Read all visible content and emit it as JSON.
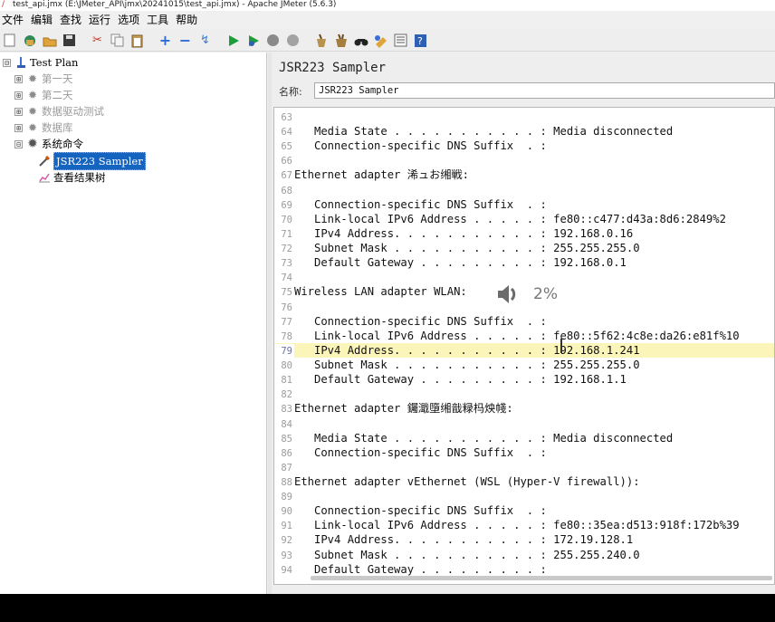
{
  "window": {
    "title": "test_api.jmx (E:\\JMeter_API\\jmx\\20241015\\test_api.jmx) - Apache JMeter (5.6.3)"
  },
  "menu": [
    "文件",
    "编辑",
    "查找",
    "运行",
    "选项",
    "工具",
    "帮助"
  ],
  "toolbar": [
    "new-icon",
    "templates-icon",
    "open-icon",
    "save-icon",
    "cut-icon",
    "copy-icon",
    "paste-icon",
    "expand-icon",
    "collapse-icon",
    "toggle-icon",
    "start-icon",
    "start-no-pause-icon",
    "stop-icon",
    "shutdown-icon",
    "clear-icon",
    "clear-all-icon",
    "search-icon",
    "reset-search-icon",
    "function-helper-icon",
    "help-icon"
  ],
  "tree": {
    "items": [
      {
        "label": "Test Plan",
        "toggle": "⊟"
      },
      {
        "label": "第一天",
        "toggle": "⊞"
      },
      {
        "label": "第二天",
        "toggle": "⊞"
      },
      {
        "label": "数据驱动测试",
        "toggle": "⊞"
      },
      {
        "label": "数据库",
        "toggle": "⊞"
      },
      {
        "label": "系统命令",
        "toggle": "⊟"
      },
      {
        "label": "JSR223 Sampler"
      },
      {
        "label": "查看结果树"
      }
    ]
  },
  "sampler": {
    "title": "JSR223 Sampler",
    "name_label": "名称:",
    "name_value": "JSR223 Sampler"
  },
  "editor": {
    "lines": [
      {
        "n": "63",
        "text": ""
      },
      {
        "n": "64",
        "text": "   Media State . . . . . . . . . . . : Media disconnected"
      },
      {
        "n": "65",
        "text": "   Connection-specific DNS Suffix  . :"
      },
      {
        "n": "66",
        "text": ""
      },
      {
        "n": "67",
        "text": "Ethernet adapter 浠ュお缃戦:"
      },
      {
        "n": "68",
        "text": ""
      },
      {
        "n": "69",
        "text": "   Connection-specific DNS Suffix  . :"
      },
      {
        "n": "70",
        "text": "   Link-local IPv6 Address . . . . . : fe80::c477:d43a:8d6:2849%2"
      },
      {
        "n": "71",
        "text": "   IPv4 Address. . . . . . . . . . . : 192.168.0.16"
      },
      {
        "n": "72",
        "text": "   Subnet Mask . . . . . . . . . . . : 255.255.255.0"
      },
      {
        "n": "73",
        "text": "   Default Gateway . . . . . . . . . : 192.168.0.1"
      },
      {
        "n": "74",
        "text": ""
      },
      {
        "n": "75",
        "text": "Wireless LAN adapter WLAN:"
      },
      {
        "n": "76",
        "text": ""
      },
      {
        "n": "77",
        "text": "   Connection-specific DNS Suffix  . :"
      },
      {
        "n": "78",
        "text": "   Link-local IPv6 Address . . . . . : fe80::5f62:4c8e:da26:e81f%10"
      },
      {
        "n": "79",
        "text": "   IPv4 Address. . . . . . . . . . . : 192.168.1.241",
        "highlight": true
      },
      {
        "n": "80",
        "text": "   Subnet Mask . . . . . . . . . . . : 255.255.255.0"
      },
      {
        "n": "81",
        "text": "   Default Gateway . . . . . . . . . : 192.168.1.1"
      },
      {
        "n": "82",
        "text": ""
      },
      {
        "n": "83",
        "text": "Ethernet adapter 钃濈墮缃戠粶杩炴帴:"
      },
      {
        "n": "84",
        "text": ""
      },
      {
        "n": "85",
        "text": "   Media State . . . . . . . . . . . : Media disconnected"
      },
      {
        "n": "86",
        "text": "   Connection-specific DNS Suffix  . :"
      },
      {
        "n": "87",
        "text": ""
      },
      {
        "n": "88",
        "text": "Ethernet adapter vEthernet (WSL (Hyper-V firewall)):"
      },
      {
        "n": "89",
        "text": ""
      },
      {
        "n": "90",
        "text": "   Connection-specific DNS Suffix  . :"
      },
      {
        "n": "91",
        "text": "   Link-local IPv6 Address . . . . . : fe80::35ea:d513:918f:172b%39"
      },
      {
        "n": "92",
        "text": "   IPv4 Address. . . . . . . . . . . : 172.19.128.1"
      },
      {
        "n": "93",
        "text": "   Subnet Mask . . . . . . . . . . . : 255.255.240.0"
      },
      {
        "n": "94",
        "text": "   Default Gateway . . . . . . . . . :"
      }
    ]
  },
  "volume_overlay": {
    "percent": "2%",
    "icon": "speaker-icon"
  }
}
